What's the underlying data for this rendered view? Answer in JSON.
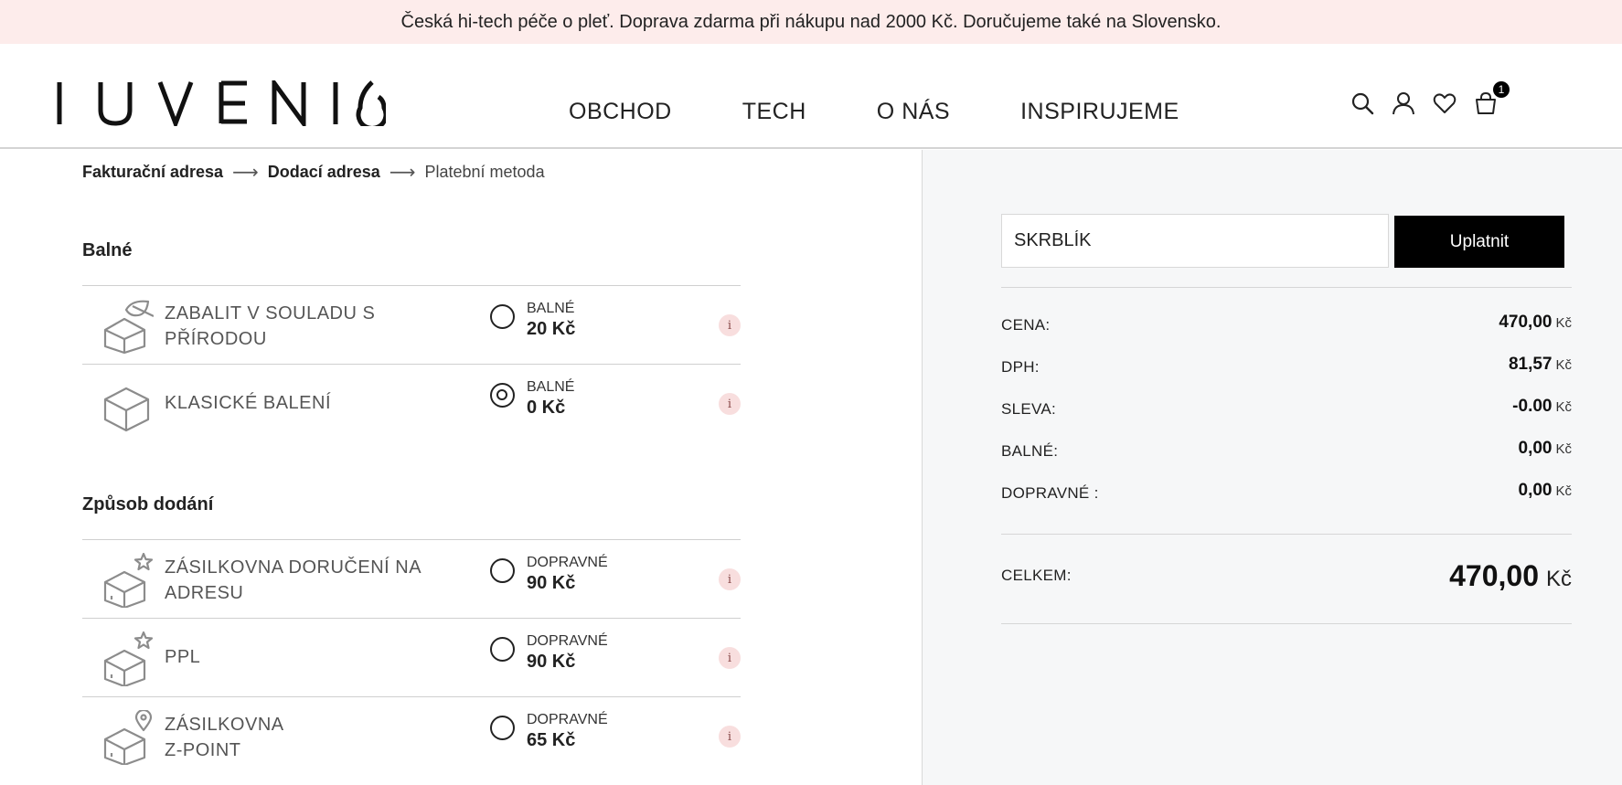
{
  "announcement": "Česká hi-tech péče o pleť. Doprava zdarma při nákupu nad 2000 Kč. Doručujeme také na Slovensko.",
  "nav": [
    "OBCHOD",
    "TECH",
    "O NÁS",
    "INSPIRUJEME"
  ],
  "cart_count": "1",
  "breadcrumbs": {
    "step1": "Fakturační adresa",
    "step2": "Dodací adresa",
    "step3": "Platební metoda",
    "arrow": "⟶"
  },
  "packaging": {
    "title": "Balné",
    "options": [
      {
        "label": "ZABALIT V SOULADU S PŘÍRODOU",
        "price_label": "BALNÉ",
        "price": "20 Kč",
        "selected": false,
        "icon": "eco-box-icon"
      },
      {
        "label": "KLASICKÉ BALENÍ",
        "price_label": "BALNÉ",
        "price": "0 Kč",
        "selected": true,
        "icon": "box-icon"
      }
    ]
  },
  "shipping": {
    "title": "Způsob dodání",
    "options": [
      {
        "label": "ZÁSILKOVNA DORUČENÍ NA ADRESU",
        "price_label": "DOPRAVNÉ",
        "price": "90 Kč",
        "selected": false,
        "icon": "star-box-icon"
      },
      {
        "label": "PPL",
        "price_label": "DOPRAVNÉ",
        "price": "90 Kč",
        "selected": false,
        "icon": "star-box-icon"
      },
      {
        "label": "ZÁSILKOVNA\nZ-POINT",
        "price_label": "DOPRAVNÉ",
        "price": "65 Kč",
        "selected": false,
        "icon": "pin-box-icon"
      }
    ]
  },
  "info_glyph": "i",
  "coupon": {
    "value": "SKRBLÍK",
    "button": "Uplatnit"
  },
  "summary": {
    "rows": [
      {
        "label": "CENA:",
        "value": "470,00",
        "currency": "Kč"
      },
      {
        "label": "DPH:",
        "value": "81,57",
        "currency": "Kč"
      },
      {
        "label": "SLEVA:",
        "value": "-0.00",
        "currency": "Kč"
      },
      {
        "label": "BALNÉ:",
        "value": "0,00",
        "currency": "Kč"
      },
      {
        "label": "DOPRAVNÉ :",
        "value": "0,00",
        "currency": "Kč"
      }
    ],
    "total_label": "CELKEM:",
    "total_value": "470,00",
    "total_currency": "Kč"
  },
  "colors": {
    "announcement_bg": "#fdeceb",
    "summary_bg": "#f6f7f8",
    "button_bg": "#000000",
    "info_bg": "#f8dede"
  }
}
